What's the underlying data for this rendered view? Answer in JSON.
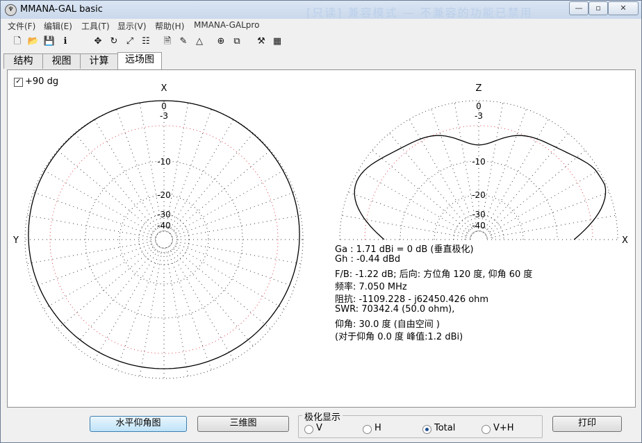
{
  "window": {
    "title": "MMANA-GAL basic",
    "title_overlay": "[只读] 兼容模式 — 不兼容的功能已禁用",
    "minimize": "—",
    "restore": "▫",
    "close": "✕"
  },
  "menu": [
    "文件(F)",
    "编辑(E)",
    "工具(T)",
    "显示(V)",
    "帮助(H)",
    "MMANA-GALpro"
  ],
  "toolbar": [
    {
      "name": "new-file-icon",
      "glyph": "🗋"
    },
    {
      "name": "open-folder-icon",
      "glyph": "📂"
    },
    {
      "name": "save-disk-icon",
      "glyph": "💾"
    },
    {
      "name": "info-icon",
      "glyph": "ℹ"
    },
    {
      "name": "move-arrows-icon",
      "glyph": "✥"
    },
    {
      "name": "rotate-icon",
      "glyph": "↻"
    },
    {
      "name": "scale-icon",
      "glyph": "⤢"
    },
    {
      "name": "equalizer-icon",
      "glyph": "☷"
    },
    {
      "name": "document-icon",
      "glyph": "🗎"
    },
    {
      "name": "edit-pen-icon",
      "glyph": "✎"
    },
    {
      "name": "triangle-icon",
      "glyph": "△"
    },
    {
      "name": "target-icon",
      "glyph": "⊕"
    },
    {
      "name": "copy-icon",
      "glyph": "⧉"
    },
    {
      "name": "tools-icon",
      "glyph": "⚒"
    },
    {
      "name": "calculator-icon",
      "glyph": "▦"
    }
  ],
  "tabs": [
    "结构",
    "视图",
    "计算",
    "远场图"
  ],
  "active_tab": "远场图",
  "checkbox": {
    "label": "+90 dg",
    "checked": true,
    "mark": "✓"
  },
  "plot": {
    "ring_labels": [
      "0",
      "-3",
      "-10",
      "-20",
      "-30",
      "-40"
    ],
    "left_top_axis": "X",
    "left_side_axis": "Y",
    "right_top_axis": "Z",
    "right_side_axis": "X"
  },
  "info": [
    "Ga : 1.71 dBi = 0 dB  (垂直极化)",
    "Gh : -0.44 dBd",
    "F/B: -1.22 dB; 后向: 方位角 120 度,  仰角 60 度",
    "频率: 7.050 MHz",
    "阻抗: -1109.228 - j62450.426 ohm",
    "SWR: 70342.4 (50.0 ohm),",
    "仰角: 30.0 度 (自由空间 )",
    "(对于仰角 0.0 度 峰值:1.2 dBi)"
  ],
  "buttons": {
    "horizontal_elevation": "水平仰角图",
    "three_d": "三维图",
    "print": "打印"
  },
  "polarization": {
    "title": "极化显示",
    "options": [
      "V",
      "H",
      "Total",
      "V+H"
    ],
    "selected": "Total"
  }
}
